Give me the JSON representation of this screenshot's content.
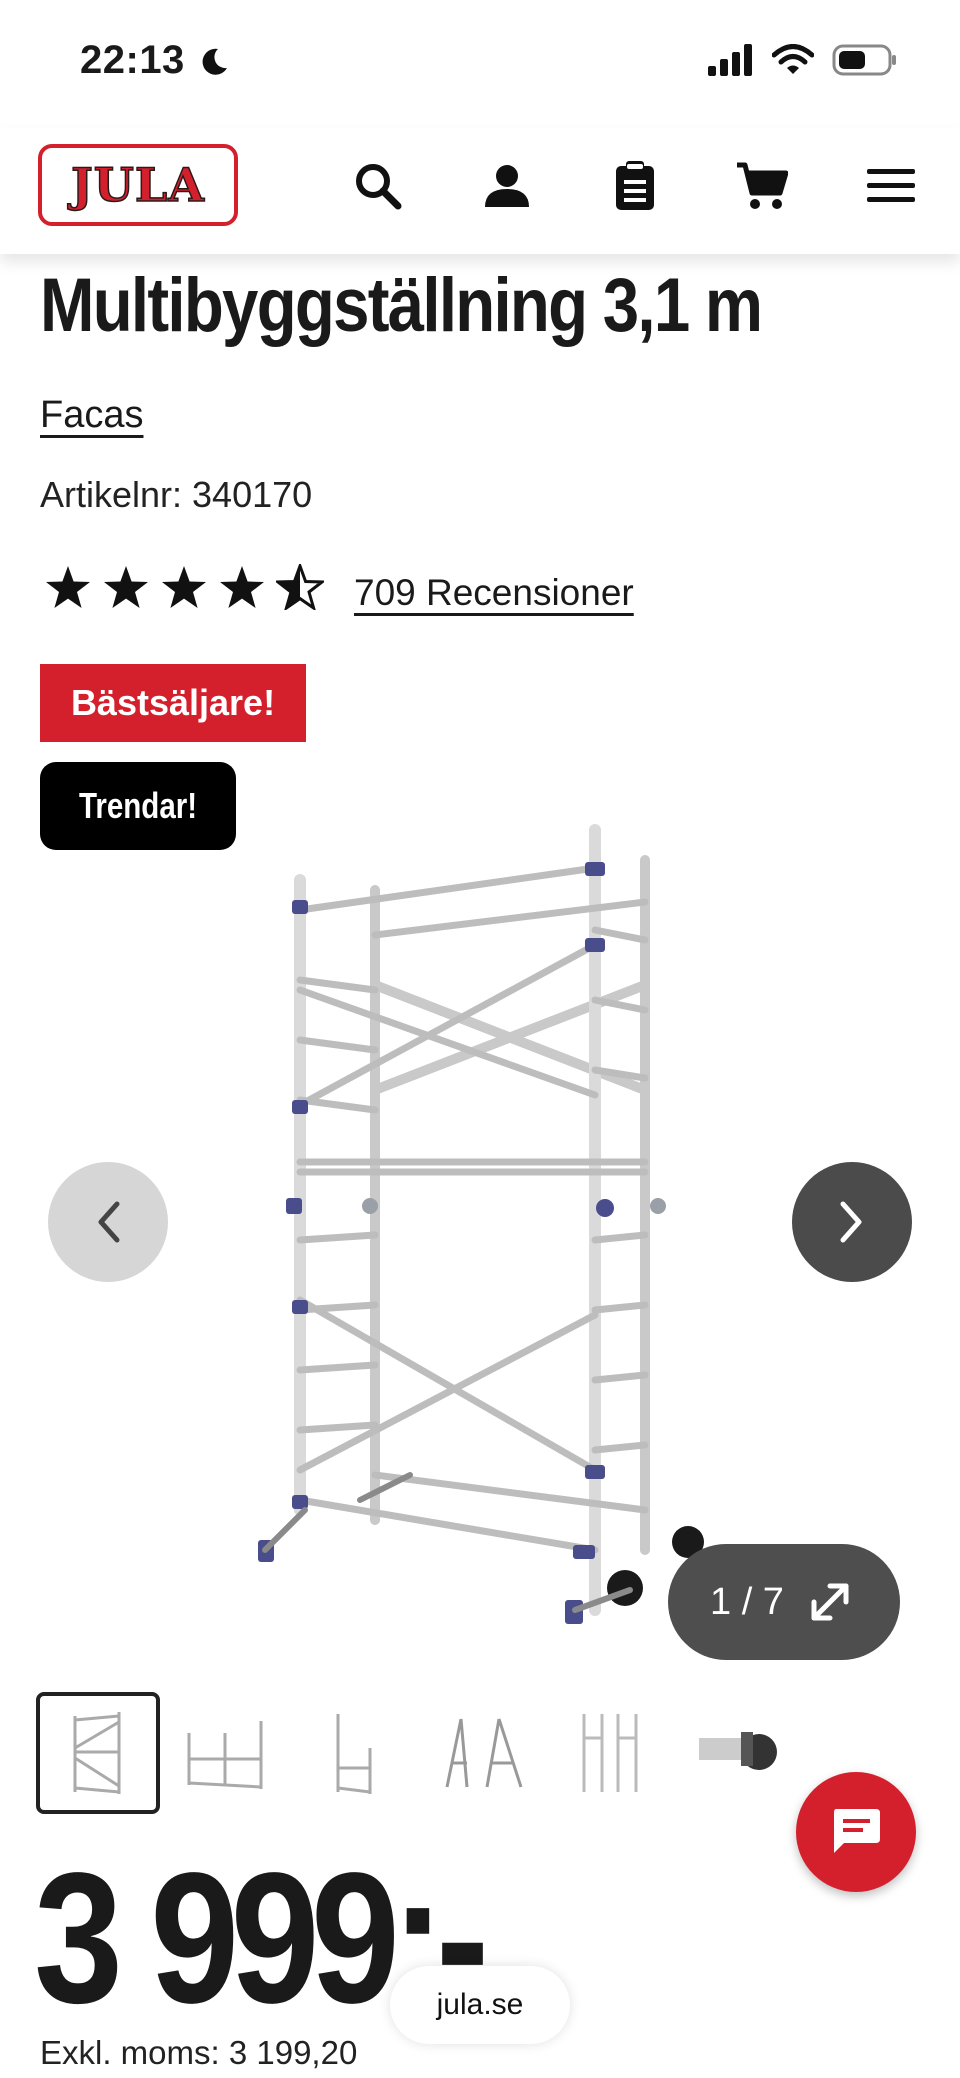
{
  "status_bar": {
    "time": "22:13"
  },
  "header": {
    "logo_text": "JULA",
    "icons": [
      "search-icon",
      "account-icon",
      "clipboard-icon",
      "cart-icon",
      "menu-icon"
    ]
  },
  "product": {
    "title": "Multibyggställning 3,1 m",
    "brand": "Facas",
    "article_number": "Artikelnr: 340170",
    "rating_stars": 4.5,
    "reviews_label": "709 Recensioner",
    "badges": [
      "Bästsäljare!",
      "Trendar!"
    ],
    "price": "3 999:-",
    "price_ex_vat": "Exkl. moms: 3 199,20"
  },
  "gallery": {
    "counter": "1 / 7",
    "thumbnail_count": 6,
    "active_index": 0
  },
  "browser": {
    "url": "jula.se"
  },
  "colors": {
    "brand_red": "#d4202c",
    "dark": "#1a1a1a",
    "nav_next": "#4b4b4b",
    "nav_prev": "#d6d6d6"
  }
}
